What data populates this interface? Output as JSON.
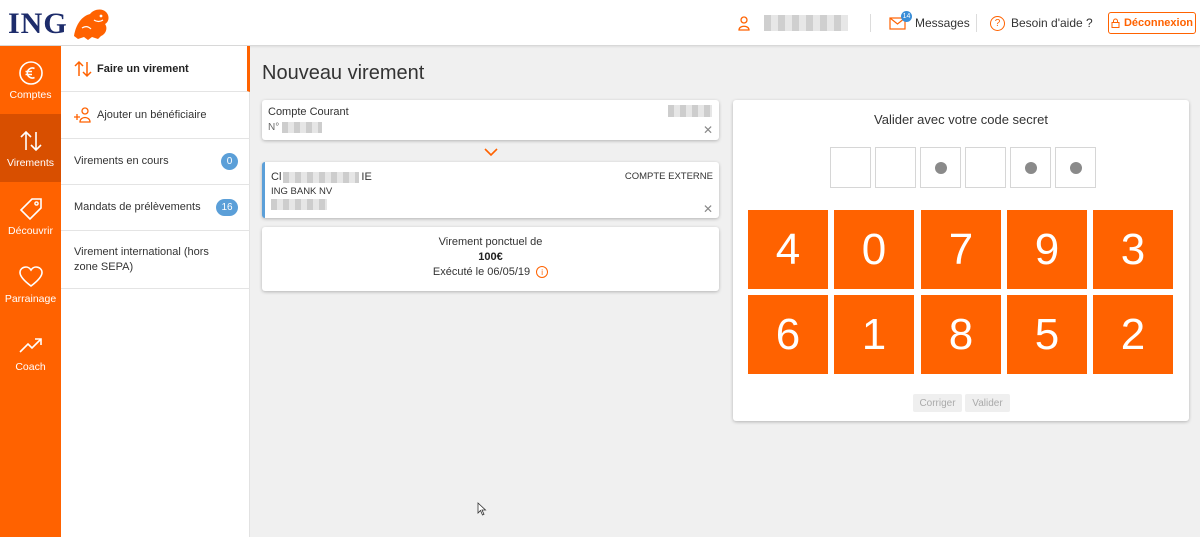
{
  "header": {
    "logo_text": "ING",
    "messages_label": "Messages",
    "messages_count": "14",
    "help_label": "Besoin d'aide ?",
    "logout_label": "Déconnexion"
  },
  "sidebar": {
    "items": [
      {
        "label": "Comptes",
        "icon": "euro-icon"
      },
      {
        "label": "Virements",
        "icon": "transfer-icon"
      },
      {
        "label": "Découvrir",
        "icon": "tag-icon"
      },
      {
        "label": "Parrainage",
        "icon": "heart-icon"
      },
      {
        "label": "Coach",
        "icon": "trend-icon"
      }
    ]
  },
  "submenu": {
    "items": [
      {
        "label": "Faire un virement"
      },
      {
        "label": "Ajouter un bénéficiaire"
      },
      {
        "label": "Virements en cours",
        "count": "0"
      },
      {
        "label": "Mandats de prélèvements",
        "count": "16"
      },
      {
        "label": "Virement international (hors zone SEPA)"
      }
    ]
  },
  "main": {
    "title": "Nouveau virement",
    "from_account": {
      "name": "Compte Courant",
      "number_prefix": "N°"
    },
    "to_account": {
      "name_start": "Cl",
      "name_end": "IE",
      "bank": "ING BANK NV",
      "type": "COMPTE EXTERNE"
    },
    "transfer": {
      "label": "Virement ponctuel de",
      "amount": "100€",
      "executed": "Exécuté le 06/05/19"
    }
  },
  "pin": {
    "title": "Valider avec votre code secret",
    "slots": [
      false,
      false,
      true,
      false,
      true,
      true
    ],
    "keys": [
      "4",
      "0",
      "7",
      "9",
      "3",
      "6",
      "1",
      "8",
      "5",
      "2"
    ],
    "correct_label": "Corriger",
    "validate_label": "Valider"
  },
  "colors": {
    "accent": "#ff6200",
    "accent_dark": "#d84f00",
    "brand_blue": "#1d2c6b",
    "badge_blue": "#5b9fd8"
  }
}
